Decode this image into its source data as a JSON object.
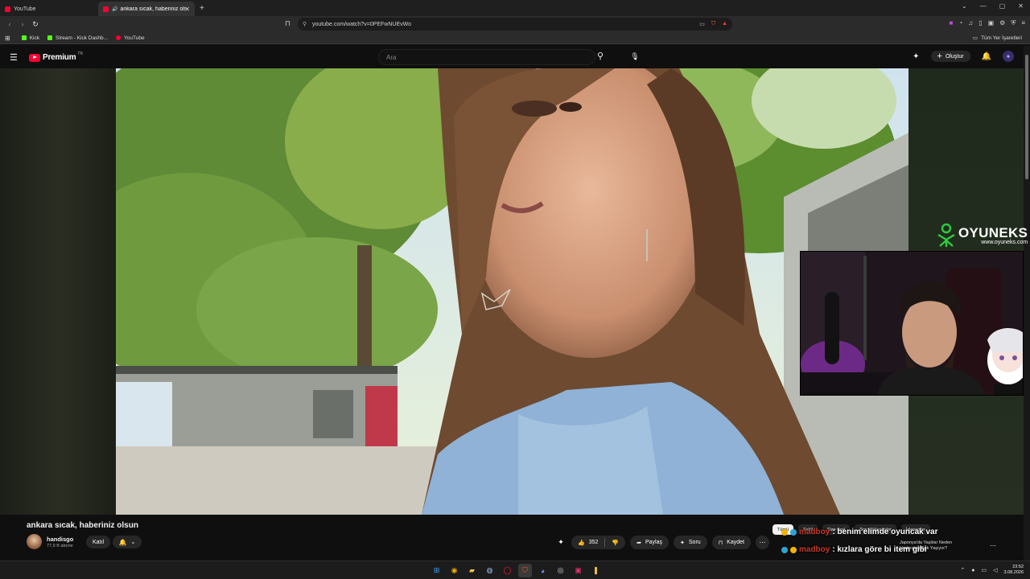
{
  "browser": {
    "tabs": [
      {
        "label": "YouTube",
        "active": false
      },
      {
        "label": "ankara sıcak, haberiniz olsun",
        "active": true
      }
    ],
    "new_tab": "+",
    "window_controls": [
      "⌄",
      "—",
      "▢",
      "✕"
    ],
    "url": "youtube.com/watch?v=0PEFwNUEvWo",
    "bookmarks": [
      {
        "label": "Kick",
        "color": "#53fc18"
      },
      {
        "label": "Stream - Kick Dashb...",
        "color": "#53fc18"
      },
      {
        "label": "YouTube",
        "color": "#ff0033"
      }
    ],
    "all_bookmarks": "Tüm Yer İşaretleri"
  },
  "youtube": {
    "logo_text": "Premium",
    "logo_country": "TR",
    "search_placeholder": "Ara",
    "create_label": "Oluştur",
    "avatar_letter": "✦"
  },
  "stream_overlay": {
    "brand": "OYUNEKS",
    "brand_url": "www.oyuneks.com"
  },
  "video": {
    "title": "ankara sıcak, haberiniz olsun",
    "channel": "handisgo",
    "subscribers": "77,9 B abone",
    "join_label": "Katıl",
    "likes": "352",
    "share_label": "Paylaş",
    "ask_label": "Soru",
    "save_label": "Kaydet"
  },
  "chips": [
    "Tümü",
    "Şekil",
    "Size özel",
    "Son yüklenenler",
    "İzlenenler"
  ],
  "chat": [
    {
      "user": "madboy",
      "message": ": benim elimde oyuncak var"
    },
    {
      "user": "madboy",
      "message": ": kızlara göre bi item gibi"
    }
  ],
  "promo_text": [
    "Japonya'da Yaşlılar Neden",
    "Herkesten Çok Yaşıyor?"
  ],
  "taskbar": {
    "time": "23:52",
    "date": "3.08.2026"
  },
  "colors": {
    "youtube_red": "#ff0033",
    "kick_green": "#53fc18",
    "chat_user": "#c53a2a"
  }
}
